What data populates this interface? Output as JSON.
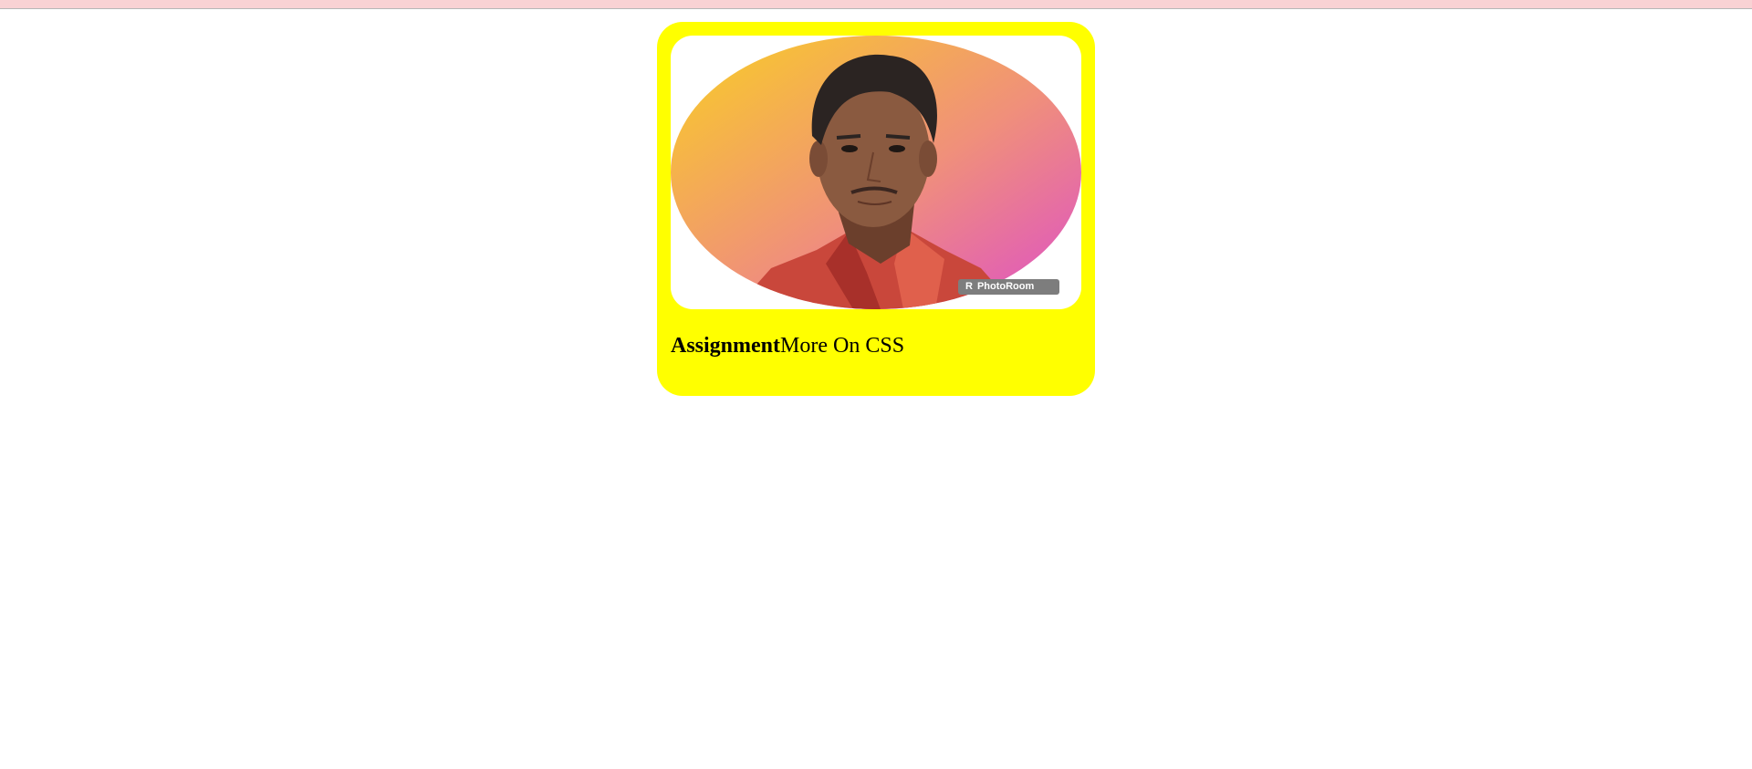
{
  "colors": {
    "page_background": "#ffffff",
    "top_strip": "#f9d2d4",
    "card_background": "#ffff00",
    "gradient_start": "#f9cf24",
    "gradient_mid": "#f0907a",
    "gradient_end": "#dd4fc8"
  },
  "card": {
    "photo": {
      "alt": "profile photo",
      "watermark": "PhotoRoom"
    },
    "caption": {
      "bold_text": "Assignment",
      "text": "More On CSS"
    }
  }
}
